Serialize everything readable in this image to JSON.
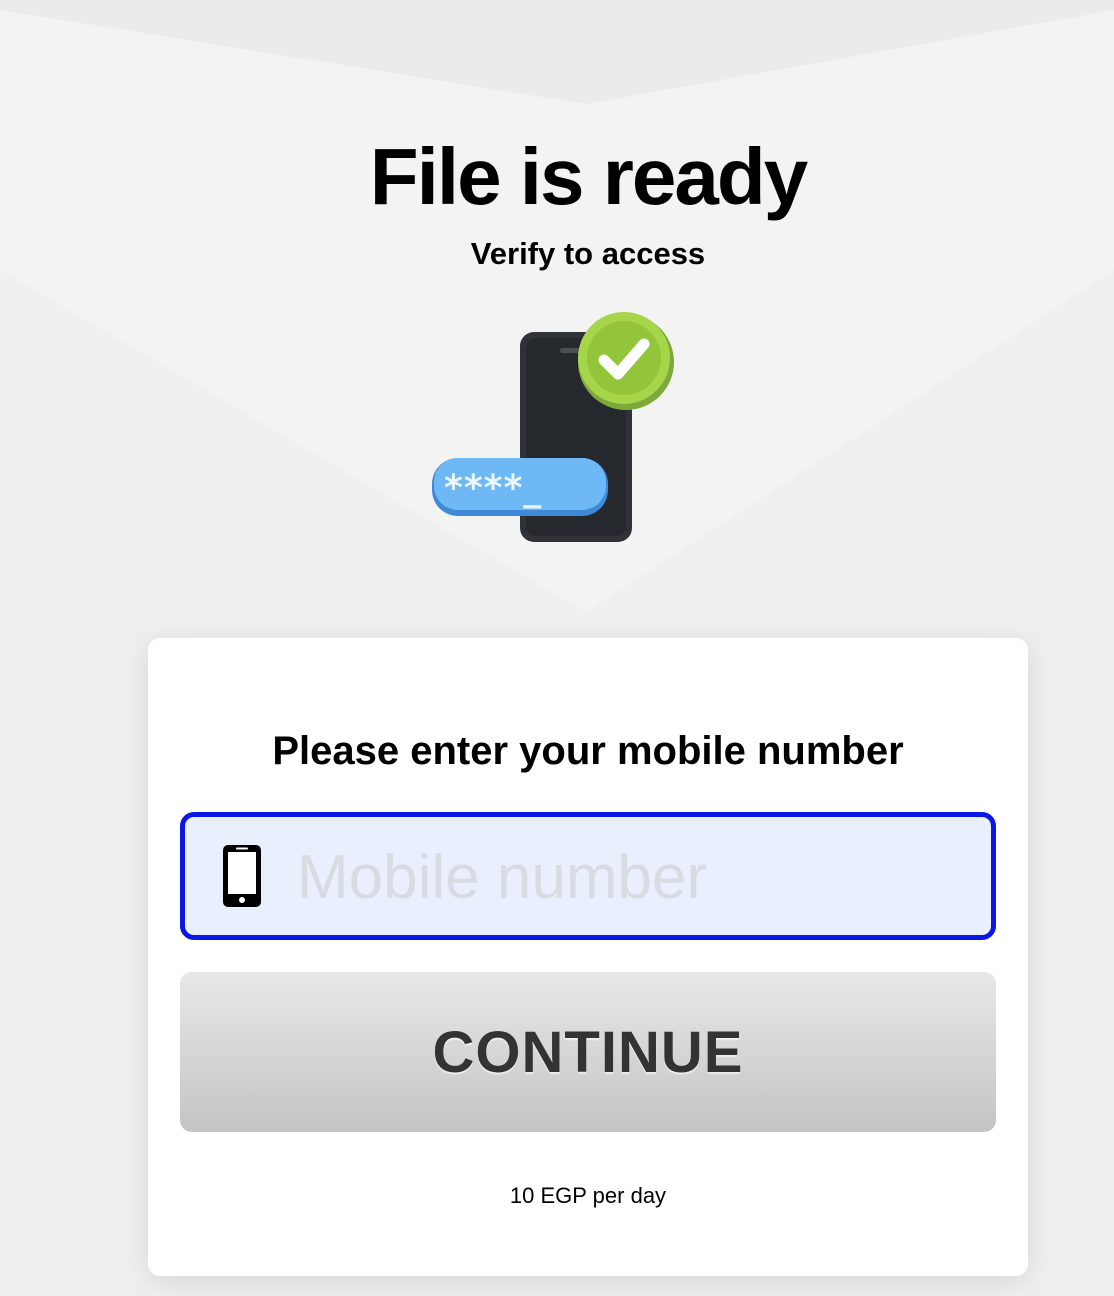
{
  "header": {
    "title": "File is ready",
    "subtitle": "Verify to access"
  },
  "hero": {
    "pin_text": "****_",
    "icon": "phone-verified-illustration"
  },
  "form": {
    "prompt": "Please enter your mobile number",
    "mobile_placeholder": "Mobile number",
    "mobile_value": "",
    "field_icon": "mobile-phone-icon",
    "continue_label": "CONTINUE",
    "price_note": "10 EGP per day"
  },
  "colors": {
    "background": "#efefef",
    "card": "#ffffff",
    "field_border": "#0a17e6",
    "field_fill": "#e9effc",
    "check_badge": "#a6d54a",
    "pin_bubble": "#6db8f5"
  }
}
